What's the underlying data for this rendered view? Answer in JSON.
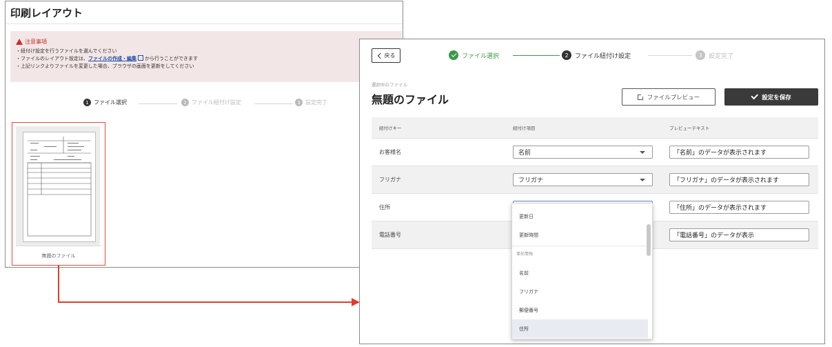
{
  "left_panel": {
    "title": "印刷レイアウト",
    "notice": {
      "title": "注意事項",
      "line1": "・紐付け設定を行うファイルを選んでください",
      "line2_prefix": "・ファイルのレイアウト設定は、",
      "line2_link": "ファイルの作成・編集",
      "line2_suffix": "から行うことができます",
      "line3": "・上記リンクよりファイルを変更した場合、ブラウザの画面を更新をしてください"
    },
    "steps": [
      {
        "num": "1",
        "label": "ファイル選択"
      },
      {
        "num": "2",
        "label": "ファイル紐付け設定"
      },
      {
        "num": "3",
        "label": "設定完了"
      }
    ],
    "file_card": {
      "label": "無題のファイル"
    }
  },
  "right_panel": {
    "back_label": "戻る",
    "steps": [
      {
        "num": "",
        "label": "ファイル選択"
      },
      {
        "num": "2",
        "label": "ファイル紐付け設定"
      },
      {
        "num": "3",
        "label": "設定完了"
      }
    ],
    "selected_file_caption": "選択中のファイル",
    "file_title": "無題のファイル",
    "preview_button": "ファイルプレビュー",
    "save_button": "設定を保存",
    "table": {
      "headers": [
        "紐付けキー",
        "紐付け項目",
        "プレビューテキスト"
      ],
      "rows": [
        {
          "key": "お客様名",
          "item": "名前",
          "preview": "「名前」のデータが表示されます"
        },
        {
          "key": "フリガナ",
          "item": "フリガナ",
          "preview": "「フリガナ」のデータが表示されます"
        },
        {
          "key": "住所",
          "item": "",
          "preview": "「住所」のデータが表示されます"
        },
        {
          "key": "電話番号",
          "item": "",
          "preview": "「電話番号」のデータが表示"
        }
      ]
    },
    "dropdown": {
      "items_top": [
        "更新日",
        "更新時間"
      ],
      "group_label": "事前情報",
      "items_group": [
        "名前",
        "フリガナ",
        "郵便番号",
        "住所"
      ],
      "selected": "住所"
    }
  },
  "colors": {
    "accent_red": "#e23b2e",
    "step_green": "#3a9a4a",
    "notice_bg": "#f3e6e6",
    "save_bg": "#3a3a3a"
  }
}
